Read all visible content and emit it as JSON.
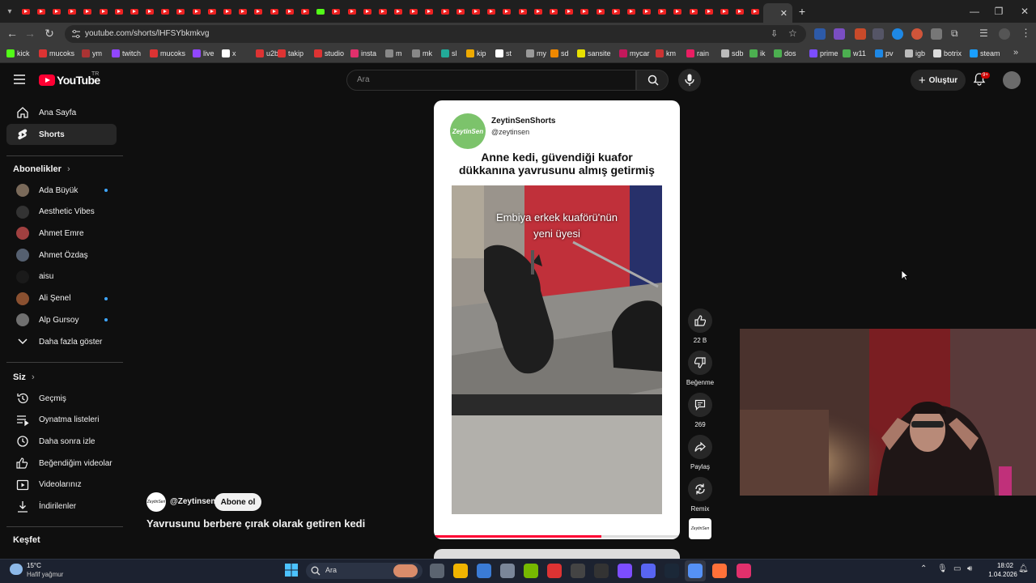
{
  "browser": {
    "url": "youtube.com/shorts/lHFSYbkmkvg",
    "bookmarks": [
      "kick",
      "mucoks",
      "ym",
      "twitch",
      "mucoks",
      "live",
      "x",
      "u2b",
      "takip",
      "studio",
      "insta",
      "m",
      "mk",
      "sl",
      "kip",
      "st",
      "my",
      "sd",
      "sansite",
      "mycar",
      "km",
      "rain",
      "sdb",
      "ik",
      "dos",
      "prime",
      "w11",
      "pv",
      "igb",
      "botrix",
      "steam"
    ]
  },
  "youtube": {
    "logo_text": "YouTube",
    "region": "TR",
    "search_placeholder": "Ara",
    "create_label": "Oluştur",
    "notif_badge": "9+"
  },
  "sidebar": {
    "home": "Ana Sayfa",
    "shorts": "Shorts",
    "subs_title": "Abonelikler",
    "subscriptions": [
      {
        "name": "Ada Büyük",
        "dot": true,
        "color": "#7a6a5a"
      },
      {
        "name": "Aesthetic Vibes",
        "dot": false,
        "color": "#333333"
      },
      {
        "name": "Ahmet Emre",
        "dot": false,
        "color": "#a04040"
      },
      {
        "name": "Ahmet Özdaş",
        "dot": false,
        "color": "#556070"
      },
      {
        "name": "aisu",
        "dot": false,
        "color": "#1a1a1a"
      },
      {
        "name": "Ali Şenel",
        "dot": true,
        "color": "#8a5030"
      },
      {
        "name": "Alp Gursoy",
        "dot": true,
        "color": "#707070"
      }
    ],
    "show_more": "Daha fazla göster",
    "you_title": "Siz",
    "you_items": [
      "Geçmiş",
      "Oynatma listeleri",
      "Daha sonra izle",
      "Beğendiğim videolar",
      "Videolarınız",
      "İndirilenler"
    ],
    "explore_title": "Keşfet"
  },
  "short": {
    "channel_display": "ZeytinSenShorts",
    "handle_card": "@zeytinsen",
    "headline": "Anne kedi, güvendiği kuafor dükkanına yavrusunu almış getirmiş",
    "headline_line1": "Anne kedi, güvendiği kuafor",
    "headline_line2": "dükkanına yavrusunu almış getirmiş",
    "video_caption_line1": "Embiya erkek kuaförü'nün",
    "video_caption_line2": "yeni üyesi",
    "logo_text": "ZeytinSen",
    "channel_handle": "@Zeytinsen",
    "subscribe_label": "Abone ol",
    "title": "Yavrusunu berbere çırak olarak getiren kedi",
    "progress": 0.68
  },
  "actions": {
    "like_count": "22 B",
    "dislike_label": "Beğenme",
    "comment_count": "269",
    "share_label": "Paylaş",
    "remix_label": "Remix"
  },
  "taskbar": {
    "weather_temp": "15°C",
    "weather_desc": "Hafif yağmur",
    "search_label": "Ara",
    "time": "18:02",
    "date": "1.04.2026"
  }
}
